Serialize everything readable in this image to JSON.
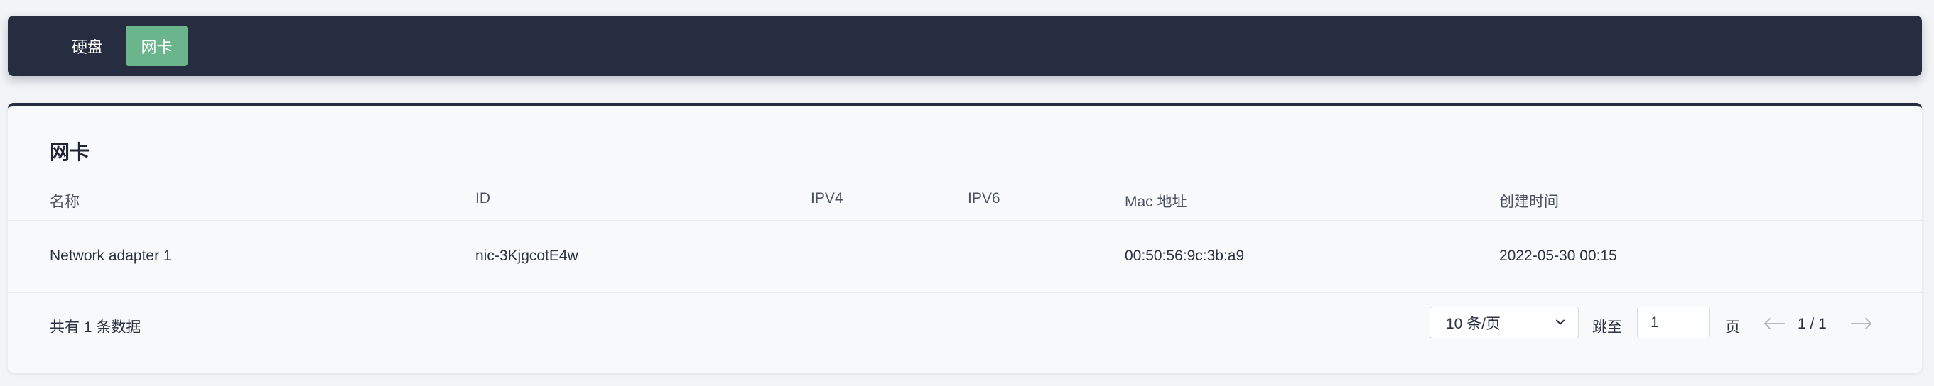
{
  "tabs": [
    {
      "label": "硬盘",
      "active": false
    },
    {
      "label": "网卡",
      "active": true
    }
  ],
  "colors": {
    "topbar_bg": "#262d40",
    "active_tab": "#6bb58c",
    "panel_bg": "#f8f9fb"
  },
  "panel": {
    "title": "网卡"
  },
  "table": {
    "columns": [
      "名称",
      "ID",
      "IPV4",
      "IPV6",
      "Mac 地址",
      "创建时间"
    ],
    "rows": [
      {
        "name": "Network adapter 1",
        "id": "nic-3KjgcotE4w",
        "ipv4": "",
        "ipv6": "",
        "mac": "00:50:56:9c:3b:a9",
        "created": "2022-05-30 00:15"
      }
    ]
  },
  "pagination": {
    "total_text": "共有 1 条数据",
    "page_size": "10 条/页",
    "jump_label": "跳至",
    "jump_value": "1",
    "page_label": "页",
    "page_indicator": "1 / 1",
    "icons": {
      "size_select": "chevron-down-icon",
      "prev": "arrow-left-icon",
      "next": "arrow-right-icon"
    }
  }
}
